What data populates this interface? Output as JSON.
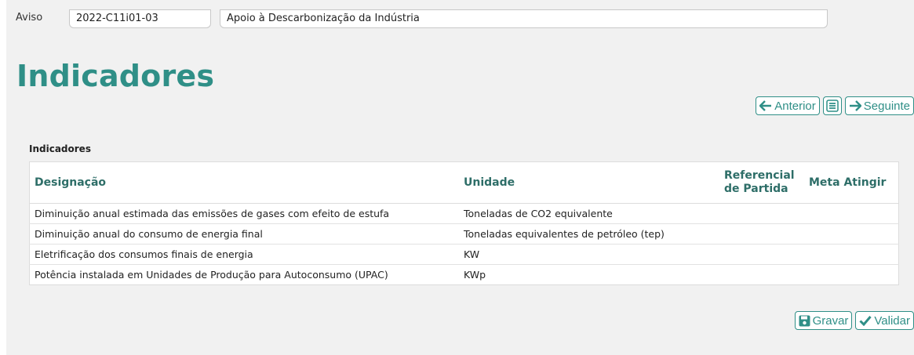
{
  "aviso": {
    "label": "Aviso",
    "code": "2022-C11i01-03",
    "description": "Apoio à Descarbonização da Indústria"
  },
  "page_title": "Indicadores",
  "nav": {
    "previous_label": "Anterior",
    "next_label": "Seguinte",
    "previous_icon": "arrow-left-icon",
    "list_icon": "list-icon",
    "next_icon": "arrow-right-icon"
  },
  "section_title": "Indicadores",
  "table": {
    "headers": {
      "designacao": "Designação",
      "unidade": "Unidade",
      "referencial": "Referencial de Partida",
      "meta": "Meta Atingir"
    },
    "rows": [
      {
        "designacao": "Diminuição anual estimada das emissões de gases com efeito de estufa",
        "unidade": "Toneladas de CO2 equivalente",
        "referencial": "",
        "meta": ""
      },
      {
        "designacao": "Diminuição anual do consumo de energia final",
        "unidade": "Toneladas equivalentes de petróleo (tep)",
        "referencial": "",
        "meta": ""
      },
      {
        "designacao": "Eletrificação dos consumos finais de energia",
        "unidade": "KW",
        "referencial": "",
        "meta": ""
      },
      {
        "designacao": "Potência instalada em Unidades de Produção para Autoconsumo (UPAC)",
        "unidade": "KWp",
        "referencial": "",
        "meta": ""
      }
    ]
  },
  "actions": {
    "save_label": "Gravar",
    "validate_label": "Validar",
    "save_icon": "floppy-disk-icon",
    "validate_icon": "checkmark-icon"
  },
  "colors": {
    "accent": "#2f8f87",
    "header_text": "#2e6e68",
    "background": "#f1f1f1"
  }
}
